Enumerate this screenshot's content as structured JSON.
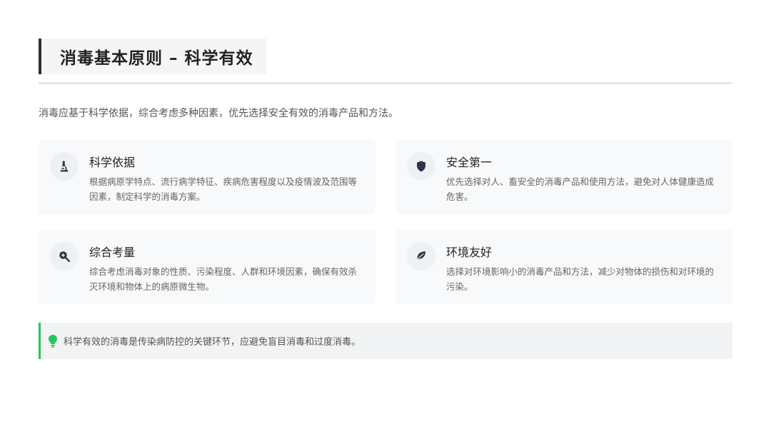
{
  "header": {
    "title": "消毒基本原则 – 科学有效"
  },
  "intro": "消毒应基于科学依据，综合考虑多种因素，优先选择安全有效的消毒产品和方法。",
  "cards": [
    {
      "icon": "microscope-icon",
      "title": "科学依据",
      "desc": "根据病原学特点、流行病学特征、疾病危害程度以及疫情波及范围等因素，制定科学的消毒方案。"
    },
    {
      "icon": "shield-icon",
      "title": "安全第一",
      "desc": "优先选择对人、畜安全的消毒产品和使用方法，避免对人体健康造成危害。"
    },
    {
      "icon": "search-plus-icon",
      "title": "综合考量",
      "desc": "综合考虑消毒对象的性质、污染程度、人群和环境因素，确保有效杀灭环境和物体上的病原微生物。"
    },
    {
      "icon": "leaf-icon",
      "title": "环境友好",
      "desc": "选择对环境影响小的消毒产品和方法，减少对物体的损伤和对环境的污染。"
    }
  ],
  "tip": {
    "icon": "lightbulb-icon",
    "text": "科学有效的消毒是传染病防控的关键环节，应避免盲目消毒和过度消毒。"
  },
  "colors": {
    "title_border": "#2f2f2f",
    "tip_accent": "#22c55e",
    "icon_color": "#2d3748"
  }
}
